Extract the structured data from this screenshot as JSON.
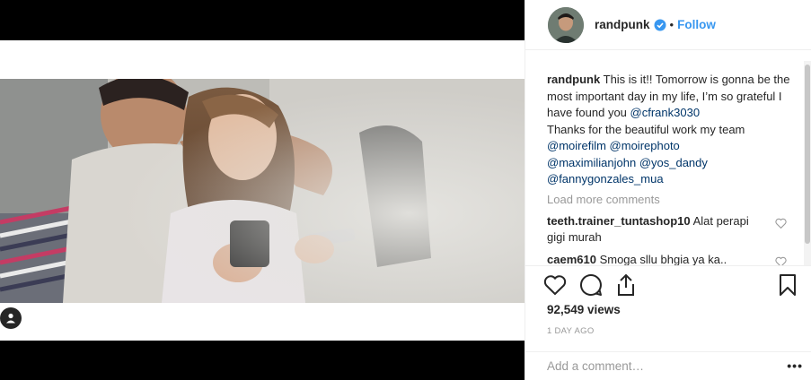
{
  "post": {
    "username": "randpunk",
    "separator": "•",
    "follow_label": "Follow",
    "avatar_icon": "profile-avatar",
    "verified_icon": "verified-badge-icon",
    "accent_color": "#3897f0"
  },
  "caption": {
    "username": "randpunk",
    "text_1": "This is it!! Tomorrow is gonna be the most important day in my life, I’m so grateful I have found you",
    "mention_1": "@cfrank3030",
    "text_2": "Thanks for the beautiful work my team",
    "mention_2": "@moirefilm",
    "mention_3": "@moirephoto",
    "mention_4": "@maximilianjohn",
    "mention_5": "@yos_dandy",
    "mention_6": "@fannygonzales_mua"
  },
  "load_more_label": "Load more comments",
  "comments": [
    {
      "username": "teeth.trainer_tuntashop10",
      "text": "Alat perapi gigi murah"
    },
    {
      "username": "caem610",
      "text": "Smoga sllu bhgia ya ka.."
    }
  ],
  "stats": {
    "views": "92,549 views",
    "time_ago": "1 DAY AGO"
  },
  "add_comment": {
    "placeholder": "Add a comment…",
    "more_label": "•••"
  },
  "icons": [
    "heart-icon",
    "comment-icon",
    "share-icon",
    "bookmark-icon",
    "user-tag-icon"
  ]
}
